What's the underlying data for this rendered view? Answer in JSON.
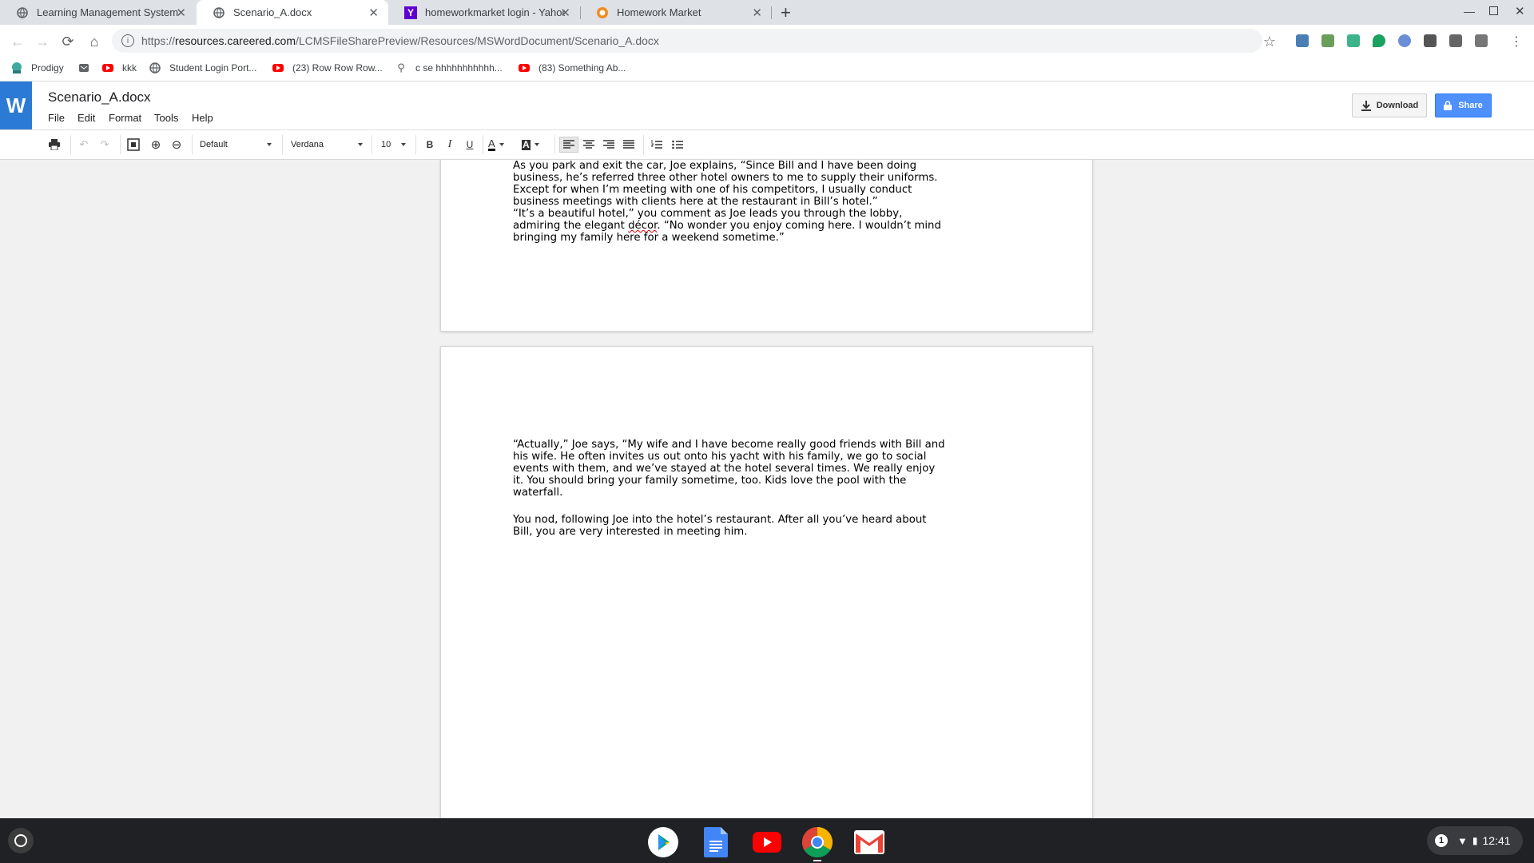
{
  "browser": {
    "tabs": [
      {
        "title": "Learning Management System",
        "icon": "globe-icon",
        "active": false
      },
      {
        "title": "Scenario_A.docx",
        "icon": "globe-icon",
        "active": true
      },
      {
        "title": "homeworkmarket login - Yahoo S",
        "icon": "yahoo-icon",
        "active": false
      },
      {
        "title": "Homework Market",
        "icon": "homework-market-icon",
        "active": false
      }
    ],
    "new_tab_label": "+",
    "url_scheme": "https://",
    "url_host": "resources.careered.com",
    "url_path": "/LCMSFileSharePreview/Resources/MSWordDocument/Scenario_A.docx",
    "bookmarks": [
      {
        "label": "Prodigy",
        "icon": "prodigy-icon"
      },
      {
        "label": "",
        "icon": "mail-icon"
      },
      {
        "label": "kkk",
        "icon": "youtube-icon"
      },
      {
        "label": "Student Login Port...",
        "icon": "globe-icon"
      },
      {
        "label": "(23) Row Row Row...",
        "icon": "youtube-icon"
      },
      {
        "label": "c se hhhhhhhhhhh...",
        "icon": "search-icon"
      },
      {
        "label": "(83) Something Ab...",
        "icon": "youtube-icon"
      }
    ]
  },
  "app": {
    "logo_letter": "W",
    "doc_title": "Scenario_A.docx",
    "menus": [
      "File",
      "Edit",
      "Format",
      "Tools",
      "Help"
    ],
    "download_label": "Download",
    "share_label": "Share",
    "accent": "#2b7bd6",
    "share_color": "#4d90fe"
  },
  "toolbar": {
    "style": "Default",
    "font": "Verdana",
    "size": "10",
    "bold": "B",
    "italic": "I",
    "underline": "U",
    "text_color": "A",
    "highlight": "A"
  },
  "document": {
    "page1": {
      "lines": [
        "As you park and exit the car, Joe explains, “Since Bill and I have been doing",
        "business, he’s referred three other hotel owners to me to supply their uniforms.",
        "Except for when I’m meeting with one of his competitors, I usually conduct",
        "business meetings with clients here at the restaurant in Bill’s hotel.”",
        "“It’s a beautiful hotel,” you comment as Joe leads you through the lobby,",
        "bringing my family here for a weekend sometime.”"
      ],
      "line6_pre": "admiring the elegant ",
      "line6_spell": "décor",
      "line6_post": ". “No wonder you enjoy coming here. I wouldn’t mind"
    },
    "page2": {
      "para1": [
        "“Actually,” Joe says, “My wife and I have become really good friends with Bill and",
        "his wife. He often invites us out onto his yacht with his family, we go to social",
        "events with them, and we’ve stayed at the hotel several times. We really enjoy",
        "it. You should bring your family sometime, too. Kids love the pool with the",
        "waterfall."
      ],
      "para2": [
        "You nod, following Joe into the hotel’s restaurant. After all you’ve heard about",
        "Bill, you are very interested in meeting him."
      ]
    }
  },
  "shelf": {
    "apps": [
      "play-store-icon",
      "google-docs-icon",
      "youtube-icon",
      "chrome-icon",
      "gmail-icon"
    ],
    "notification_count": "1",
    "time": "12:41"
  }
}
